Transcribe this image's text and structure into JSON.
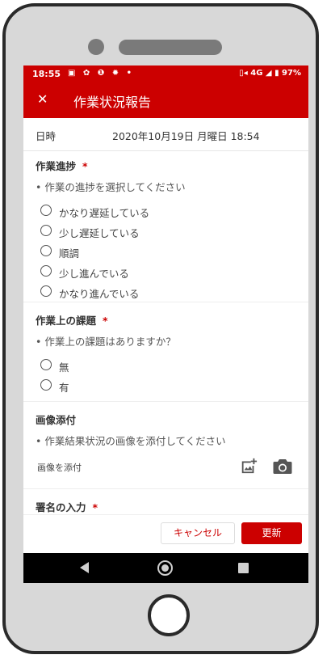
{
  "status_bar": {
    "time": "18:55",
    "notification_icons": "▣ ✿ ❶ ✹ •",
    "right": "▯◂ 4G ◢ ▮ 97%"
  },
  "app_bar": {
    "close_icon": "✕",
    "title": "作業状況報告"
  },
  "datetime": {
    "label": "日時",
    "value": "2020年10月19日 月曜日 18:54"
  },
  "progress_section": {
    "title": "作業進捗",
    "required": "*",
    "description": "• 作業の進捗を選択してください",
    "options": [
      "かなり遅延している",
      "少し遅延している",
      "順調",
      "少し進んでいる",
      "かなり進んでいる"
    ]
  },
  "issues_section": {
    "title": "作業上の課題",
    "required": "*",
    "description": "• 作業上の課題はありますか？",
    "options": [
      "無",
      "有"
    ]
  },
  "image_section": {
    "title": "画像添付",
    "description": "• 作業結果状況の画像を添付してください",
    "attach_label": "画像を添付"
  },
  "signature_section": {
    "title": "署名の入力",
    "required": "*"
  },
  "buttons": {
    "cancel": "キャンセル",
    "update": "更新"
  },
  "colors": {
    "accent": "#cc0000",
    "navbar": "#000000",
    "frame": "#d8d8d8"
  }
}
